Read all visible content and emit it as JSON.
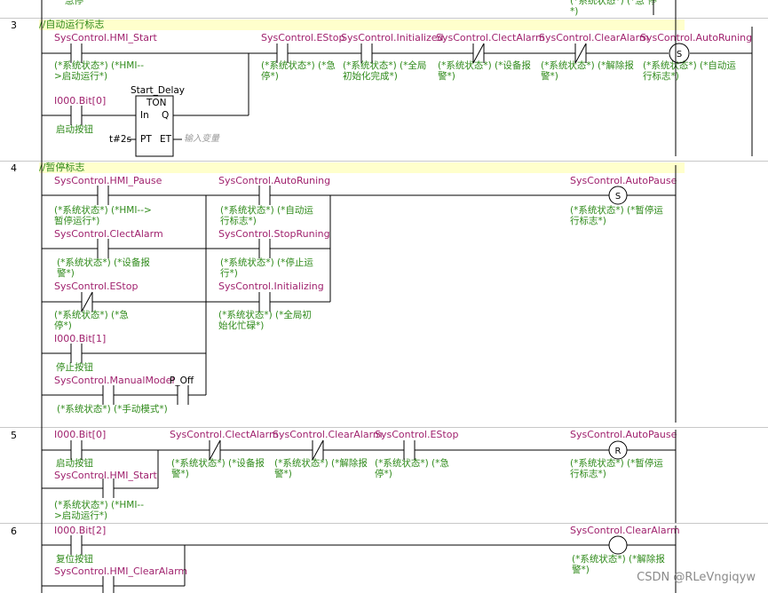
{
  "rows": [
    {
      "number": "",
      "title": "",
      "top_comment_left": "急停",
      "top_comment_right": "(*系统状态*) (*急\n停*)"
    },
    {
      "number": "3",
      "title": "//自动运行标志"
    },
    {
      "number": "4",
      "title": "//暂停标志"
    },
    {
      "number": "5"
    },
    {
      "number": "6"
    }
  ],
  "elements": {
    "r3_hmi_start": {
      "var": "SysControl.HMI_Start",
      "comment": "(*系统状态*) (*HMI-->启动运行*)"
    },
    "r3_i000_0": {
      "var": "I000.Bit[0]",
      "comment": "启动按钮"
    },
    "r3_ton": {
      "name": "Start_Delay",
      "type": "TON",
      "in": "In",
      "q": "Q",
      "pt": "PT",
      "et": "ET",
      "pt_value": "t#2s",
      "et_placeholder": "输入变量"
    },
    "r3_estop": {
      "var": "SysControl.EStop",
      "comment": "(*系统状态*) (*急停*)"
    },
    "r3_initialized": {
      "var": "SysControl.Initialized",
      "comment": "(*系统状态*) (*全局初始化完成*)"
    },
    "r3_clectalarm": {
      "var": "SysControl.ClectAlarm",
      "comment": "(*系统状态*) (*设备报警*)"
    },
    "r3_clearalarm": {
      "var": "SysControl.ClearAlarm",
      "comment": "(*系统状态*) (*解除报警*)"
    },
    "r3_autorun_coil": {
      "var": "SysControl.AutoRuning",
      "comment": "(*系统状态*) (*自动运行标志*)",
      "symbol": "S"
    },
    "r4_hmi_pause": {
      "var": "SysControl.HMI_Pause",
      "comment": "(*系统状态*) (*HMI-->暂停运行*)"
    },
    "r4_clectalarm": {
      "var": "SysControl.ClectAlarm",
      "comment": "(*系统状态*) (*设备报警*)"
    },
    "r4_estop": {
      "var": "SysControl.EStop",
      "comment": "(*系统状态*) (*急停*)"
    },
    "r4_i000_1": {
      "var": "I000.Bit[1]",
      "comment": "停止按钮"
    },
    "r4_manualmodel": {
      "var": "SysControl.ManualModel",
      "comment": "(*系统状态*) (*手动模式*)"
    },
    "r4_poff": {
      "var": "P_Off"
    },
    "r4_autorun": {
      "var": "SysControl.AutoRuning",
      "comment": "(*系统状态*) (*自动运行标志*)"
    },
    "r4_stoprun": {
      "var": "SysControl.StopRuning",
      "comment": "(*系统状态*) (*停止运行*)"
    },
    "r4_initializing": {
      "var": "SysControl.Initializing",
      "comment": "(*系统状态*) (*全局初始化忙碌*)"
    },
    "r4_autopause_coil": {
      "var": "SysControl.AutoPause",
      "comment": "(*系统状态*) (*暂停运行标志*)",
      "symbol": "S"
    },
    "r5_i000_0": {
      "var": "I000.Bit[0]",
      "comment": "启动按钮"
    },
    "r5_hmi_start": {
      "var": "SysControl.HMI_Start",
      "comment": "(*系统状态*) (*HMI-->启动运行*)"
    },
    "r5_clectalarm": {
      "var": "SysControl.ClectAlarm",
      "comment": "(*系统状态*) (*设备报警*)"
    },
    "r5_clearalarm": {
      "var": "SysControl.ClearAlarm",
      "comment": "(*系统状态*) (*解除报警*)"
    },
    "r5_estop": {
      "var": "SysControl.EStop",
      "comment": "(*系统状态*) (*急停*)"
    },
    "r5_autopause_coil": {
      "var": "SysControl.AutoPause",
      "comment": "(*系统状态*) (*暂停运行标志*)",
      "symbol": "R"
    },
    "r6_i000_2": {
      "var": "I000.Bit[2]",
      "comment": "复位按钮"
    },
    "r6_hmi_clearalarm": {
      "var": "SysControl.HMI_ClearAlarm"
    },
    "r6_clearalarm_coil": {
      "var": "SysControl.ClearAlarm",
      "comment": "(*系统状态*) (*解除报警*)",
      "symbol": ""
    }
  },
  "watermark": "CSDN @RLeVngiqyw",
  "colors": {
    "variable": "#a0226e",
    "comment": "#2f8a1a",
    "title_bg": "#ffffcc",
    "wire": "#000000"
  }
}
